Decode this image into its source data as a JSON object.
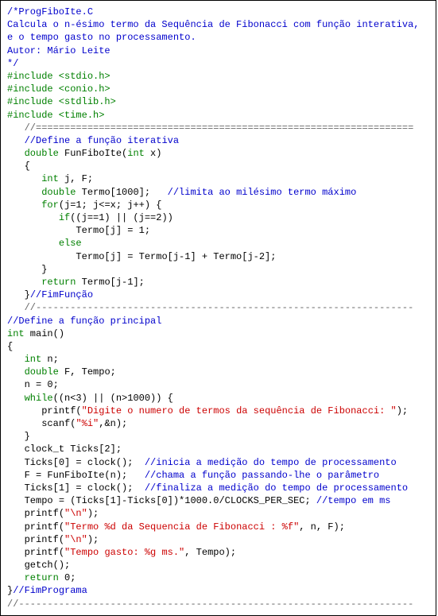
{
  "lines": [
    {
      "indent": 0,
      "spans": [
        {
          "class": "blue",
          "text": "/*ProgFiboIte.C"
        }
      ]
    },
    {
      "indent": 0,
      "spans": [
        {
          "class": "blue",
          "text": "Calcula o n-ésimo termo da Sequência de Fibonacci com função interativa,"
        }
      ]
    },
    {
      "indent": 0,
      "spans": [
        {
          "class": "blue",
          "text": "e o tempo gasto no processamento."
        }
      ]
    },
    {
      "indent": 0,
      "spans": [
        {
          "class": "blue",
          "text": "Autor: Mário Leite"
        }
      ]
    },
    {
      "indent": 0,
      "spans": [
        {
          "class": "blue",
          "text": "*/"
        }
      ]
    },
    {
      "indent": 0,
      "spans": [
        {
          "class": "green",
          "text": "#include <stdio.h>"
        }
      ]
    },
    {
      "indent": 0,
      "spans": [
        {
          "class": "green",
          "text": "#include <conio.h>"
        }
      ]
    },
    {
      "indent": 0,
      "spans": [
        {
          "class": "green",
          "text": "#include <stdlib.h>"
        }
      ]
    },
    {
      "indent": 0,
      "spans": [
        {
          "class": "green",
          "text": "#include <time.h>"
        }
      ]
    },
    {
      "indent": 1,
      "spans": [
        {
          "class": "sep",
          "text": "//=================================================================="
        }
      ]
    },
    {
      "indent": 1,
      "spans": [
        {
          "class": "blue",
          "text": "//Define a função iterativa"
        }
      ]
    },
    {
      "indent": 1,
      "spans": [
        {
          "class": "green",
          "text": "double"
        },
        {
          "class": "black",
          "text": " FunFiboIte("
        },
        {
          "class": "green",
          "text": "int"
        },
        {
          "class": "black",
          "text": " x)"
        }
      ]
    },
    {
      "indent": 1,
      "spans": [
        {
          "class": "black",
          "text": "{"
        }
      ]
    },
    {
      "indent": 2,
      "spans": [
        {
          "class": "green",
          "text": "int"
        },
        {
          "class": "black",
          "text": " j, F;"
        }
      ]
    },
    {
      "indent": 2,
      "spans": [
        {
          "class": "green",
          "text": "double"
        },
        {
          "class": "black",
          "text": " Termo[1000];   "
        },
        {
          "class": "blue",
          "text": "//limita ao milésimo termo máximo"
        }
      ]
    },
    {
      "indent": 2,
      "spans": [
        {
          "class": "green",
          "text": "for"
        },
        {
          "class": "black",
          "text": "(j=1; j<=x; j++) {"
        }
      ]
    },
    {
      "indent": 3,
      "spans": [
        {
          "class": "green",
          "text": "if"
        },
        {
          "class": "black",
          "text": "((j==1) || (j==2))"
        }
      ]
    },
    {
      "indent": 4,
      "spans": [
        {
          "class": "black",
          "text": "Termo[j] = 1;"
        }
      ]
    },
    {
      "indent": 3,
      "spans": [
        {
          "class": "green",
          "text": "else"
        }
      ]
    },
    {
      "indent": 4,
      "spans": [
        {
          "class": "black",
          "text": "Termo[j] = Termo[j-1] + Termo[j-2];"
        }
      ]
    },
    {
      "indent": 2,
      "spans": [
        {
          "class": "black",
          "text": "}"
        }
      ]
    },
    {
      "indent": 2,
      "spans": [
        {
          "class": "green",
          "text": "return"
        },
        {
          "class": "black",
          "text": " Termo[j-1];"
        }
      ]
    },
    {
      "indent": 1,
      "spans": [
        {
          "class": "black",
          "text": "}"
        },
        {
          "class": "blue",
          "text": "//FimFunção"
        }
      ]
    },
    {
      "indent": 1,
      "spans": [
        {
          "class": "sep",
          "text": "//------------------------------------------------------------------"
        }
      ]
    },
    {
      "indent": 0,
      "spans": [
        {
          "class": "blue",
          "text": "//Define a função principal"
        }
      ]
    },
    {
      "indent": 0,
      "spans": [
        {
          "class": "green",
          "text": "int"
        },
        {
          "class": "black",
          "text": " main()"
        }
      ]
    },
    {
      "indent": 0,
      "spans": [
        {
          "class": "black",
          "text": "{"
        }
      ]
    },
    {
      "indent": 1,
      "spans": [
        {
          "class": "green",
          "text": "int"
        },
        {
          "class": "black",
          "text": " n;"
        }
      ]
    },
    {
      "indent": 1,
      "spans": [
        {
          "class": "green",
          "text": "double"
        },
        {
          "class": "black",
          "text": " F, Tempo;"
        }
      ]
    },
    {
      "indent": 1,
      "spans": [
        {
          "class": "black",
          "text": "n = 0;"
        }
      ]
    },
    {
      "indent": 1,
      "spans": [
        {
          "class": "green",
          "text": "while"
        },
        {
          "class": "black",
          "text": "((n<3) || (n>1000)) {"
        }
      ]
    },
    {
      "indent": 2,
      "spans": [
        {
          "class": "black",
          "text": "printf("
        },
        {
          "class": "red",
          "text": "\"Digite o numero de termos da sequência de Fibonacci: \""
        },
        {
          "class": "black",
          "text": ");"
        }
      ]
    },
    {
      "indent": 2,
      "spans": [
        {
          "class": "black",
          "text": "scanf("
        },
        {
          "class": "red",
          "text": "\"%i\""
        },
        {
          "class": "black",
          "text": ",&n);"
        }
      ]
    },
    {
      "indent": 1,
      "spans": [
        {
          "class": "black",
          "text": "}"
        }
      ]
    },
    {
      "indent": 1,
      "spans": [
        {
          "class": "black",
          "text": "clock_t Ticks[2];"
        }
      ]
    },
    {
      "indent": 1,
      "spans": [
        {
          "class": "black",
          "text": "Ticks[0] = clock();  "
        },
        {
          "class": "blue",
          "text": "//inicia a medição do tempo de processamento"
        }
      ]
    },
    {
      "indent": 1,
      "spans": [
        {
          "class": "black",
          "text": "F = FunFiboIte(n);   "
        },
        {
          "class": "blue",
          "text": "//chama a função passando-lhe o parâmetro"
        }
      ]
    },
    {
      "indent": 1,
      "spans": [
        {
          "class": "black",
          "text": "Ticks[1] = clock();  "
        },
        {
          "class": "blue",
          "text": "//finaliza a medição do tempo de processamento"
        }
      ]
    },
    {
      "indent": 1,
      "spans": [
        {
          "class": "black",
          "text": "Tempo = (Ticks[1]-Ticks[0])*1000.0/CLOCKS_PER_SEC; "
        },
        {
          "class": "blue",
          "text": "//tempo em ms"
        }
      ]
    },
    {
      "indent": 1,
      "spans": [
        {
          "class": "black",
          "text": "printf("
        },
        {
          "class": "red",
          "text": "\"\\n\""
        },
        {
          "class": "black",
          "text": ");"
        }
      ]
    },
    {
      "indent": 1,
      "spans": [
        {
          "class": "black",
          "text": "printf("
        },
        {
          "class": "red",
          "text": "\"Termo %d da Sequencia de Fibonacci : %f\""
        },
        {
          "class": "black",
          "text": ", n, F);"
        }
      ]
    },
    {
      "indent": 1,
      "spans": [
        {
          "class": "black",
          "text": "printf("
        },
        {
          "class": "red",
          "text": "\"\\n\""
        },
        {
          "class": "black",
          "text": ");"
        }
      ]
    },
    {
      "indent": 1,
      "spans": [
        {
          "class": "black",
          "text": "printf("
        },
        {
          "class": "red",
          "text": "\"Tempo gasto: %g ms.\""
        },
        {
          "class": "black",
          "text": ", Tempo);"
        }
      ]
    },
    {
      "indent": 1,
      "spans": [
        {
          "class": "black",
          "text": "getch();"
        }
      ]
    },
    {
      "indent": 1,
      "spans": [
        {
          "class": "green",
          "text": "return"
        },
        {
          "class": "black",
          "text": " 0;"
        }
      ]
    },
    {
      "indent": 0,
      "spans": [
        {
          "class": "black",
          "text": "}"
        },
        {
          "class": "blue",
          "text": "//FimPrograma"
        }
      ]
    },
    {
      "indent": 0,
      "spans": [
        {
          "class": "sep",
          "text": "//---------------------------------------------------------------------"
        }
      ]
    }
  ],
  "indent_unit": "   "
}
